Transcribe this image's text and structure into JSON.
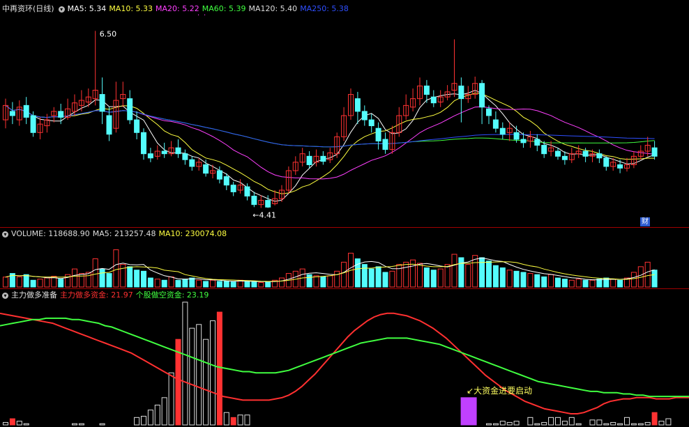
{
  "stock": {
    "name": "中再资环",
    "period": "(日线)"
  },
  "price_header": [
    {
      "label": "MA5: 5.34",
      "color": "#ffffff"
    },
    {
      "label": "MA10: 5.33",
      "color": "#ffff40"
    },
    {
      "label": "MA20: 5.22",
      "color": "#ff40ff"
    },
    {
      "label": "MA60: 5.39",
      "color": "#40ff40"
    },
    {
      "label": "MA120: 5.40",
      "color": "#dddddd"
    },
    {
      "label": "MA250: 5.38",
      "color": "#2f4fff"
    }
  ],
  "volume_header": [
    {
      "label": "VOLUME: 118688.90",
      "color": "#dddddd"
    },
    {
      "label": "MA5: 213257.48",
      "color": "#dddddd"
    },
    {
      "label": "MA10: 230074.08",
      "color": "#ffff40"
    }
  ],
  "indicator_header": {
    "name": "主力做多准备",
    "items": [
      {
        "label": "主力做多资金: 21.97",
        "color": "#ff3030"
      },
      {
        "label": "个股做空资金: 23.19",
        "color": "#40ff40"
      }
    ]
  },
  "annotations": {
    "high_label": "6.50",
    "low_label": "4.41",
    "signal_label": "大资金进要启动",
    "finance_badge": "财"
  },
  "colors": {
    "up": "#ff3232",
    "down": "#54fcfc",
    "grid": "#8b0000",
    "signal": "#c040ff"
  },
  "chart_data": [
    {
      "type": "candlestick",
      "title": "中再资环 (日线)",
      "ylim": [
        4.25,
        6.7
      ],
      "high_marker": 6.5,
      "low_marker": 4.41,
      "candles": [
        [
          5.45,
          5.62,
          5.7,
          5.35
        ],
        [
          5.55,
          5.5,
          5.66,
          5.4
        ],
        [
          5.45,
          5.6,
          5.68,
          5.38
        ],
        [
          5.62,
          5.48,
          5.72,
          5.4
        ],
        [
          5.5,
          5.3,
          5.55,
          5.25
        ],
        [
          5.3,
          5.4,
          5.48,
          5.22
        ],
        [
          5.38,
          5.45,
          5.52,
          5.3
        ],
        [
          5.5,
          5.55,
          5.6,
          5.42
        ],
        [
          5.55,
          5.48,
          5.64,
          5.4
        ],
        [
          5.48,
          5.58,
          5.7,
          5.45
        ],
        [
          5.55,
          5.65,
          5.75,
          5.5
        ],
        [
          5.62,
          5.68,
          5.8,
          5.55
        ],
        [
          5.66,
          5.72,
          5.82,
          5.6
        ],
        [
          5.7,
          5.8,
          6.5,
          5.62
        ],
        [
          5.75,
          5.55,
          5.95,
          5.4
        ],
        [
          5.5,
          5.28,
          5.6,
          5.2
        ],
        [
          5.35,
          5.68,
          5.9,
          5.3
        ],
        [
          5.7,
          5.75,
          5.9,
          5.6
        ],
        [
          5.7,
          5.45,
          5.8,
          5.4
        ],
        [
          5.45,
          5.3,
          5.55,
          5.22
        ],
        [
          5.3,
          5.05,
          5.35,
          4.98
        ],
        [
          5.05,
          5.0,
          5.12,
          4.95
        ],
        [
          5.02,
          5.08,
          5.15,
          4.98
        ],
        [
          5.08,
          5.05,
          5.18,
          5.0
        ],
        [
          5.05,
          5.12,
          5.2,
          5.02
        ],
        [
          5.12,
          5.05,
          5.22,
          5.0
        ],
        [
          5.05,
          4.98,
          5.1,
          4.92
        ],
        [
          4.98,
          4.9,
          5.02,
          4.85
        ],
        [
          4.9,
          4.95,
          5.0,
          4.85
        ],
        [
          4.92,
          4.82,
          4.98,
          4.78
        ],
        [
          4.82,
          4.85,
          4.92,
          4.76
        ],
        [
          4.85,
          4.75,
          4.9,
          4.7
        ],
        [
          4.78,
          4.68,
          4.82,
          4.62
        ],
        [
          4.68,
          4.6,
          4.72,
          4.55
        ],
        [
          4.62,
          4.68,
          4.75,
          4.58
        ],
        [
          4.66,
          4.55,
          4.7,
          4.5
        ],
        [
          4.55,
          4.45,
          4.6,
          4.42
        ],
        [
          4.45,
          4.5,
          4.56,
          4.41
        ],
        [
          4.5,
          4.42,
          4.56,
          4.41
        ],
        [
          4.46,
          4.52,
          4.62,
          4.44
        ],
        [
          4.52,
          4.62,
          4.68,
          4.48
        ],
        [
          4.62,
          4.85,
          4.9,
          4.58
        ],
        [
          4.85,
          4.95,
          5.02,
          4.8
        ],
        [
          4.95,
          5.05,
          5.12,
          4.9
        ],
        [
          5.02,
          4.92,
          5.08,
          4.88
        ],
        [
          4.95,
          5.02,
          5.1,
          4.9
        ],
        [
          5.02,
          4.96,
          5.08,
          4.92
        ],
        [
          4.98,
          5.06,
          5.12,
          4.94
        ],
        [
          5.05,
          5.25,
          5.3,
          5.0
        ],
        [
          5.25,
          5.5,
          5.6,
          5.2
        ],
        [
          5.5,
          5.75,
          5.82,
          5.45
        ],
        [
          5.7,
          5.55,
          5.78,
          5.4
        ],
        [
          5.55,
          5.45,
          5.62,
          5.38
        ],
        [
          5.45,
          5.38,
          5.52,
          5.3
        ],
        [
          5.35,
          5.2,
          5.42,
          5.1
        ],
        [
          5.22,
          5.1,
          5.3,
          5.05
        ],
        [
          5.1,
          5.3,
          5.38,
          5.05
        ],
        [
          5.3,
          5.5,
          5.6,
          5.25
        ],
        [
          5.5,
          5.62,
          5.75,
          5.45
        ],
        [
          5.6,
          5.7,
          5.82,
          5.55
        ],
        [
          5.7,
          5.85,
          5.95,
          5.62
        ],
        [
          5.85,
          5.75,
          5.92,
          5.65
        ],
        [
          5.72,
          5.65,
          5.8,
          5.6
        ],
        [
          5.66,
          5.72,
          5.8,
          5.6
        ],
        [
          5.72,
          5.78,
          5.86,
          5.68
        ],
        [
          5.8,
          5.88,
          6.4,
          5.72
        ],
        [
          5.85,
          5.7,
          5.95,
          5.42
        ],
        [
          5.7,
          5.75,
          5.85,
          5.65
        ],
        [
          5.75,
          5.88,
          5.96,
          5.7
        ],
        [
          5.88,
          5.6,
          5.92,
          5.4
        ],
        [
          5.58,
          5.5,
          5.62,
          5.4
        ],
        [
          5.45,
          5.35,
          5.55,
          5.3
        ],
        [
          5.35,
          5.28,
          5.42,
          5.22
        ],
        [
          5.3,
          5.35,
          5.42,
          5.2
        ],
        [
          5.3,
          5.22,
          5.38,
          5.18
        ],
        [
          5.22,
          5.18,
          5.3,
          5.12
        ],
        [
          5.2,
          5.25,
          5.32,
          5.12
        ],
        [
          5.22,
          5.15,
          5.28,
          5.08
        ],
        [
          5.15,
          5.05,
          5.2,
          5.0
        ],
        [
          5.08,
          5.12,
          5.2,
          5.02
        ],
        [
          5.08,
          5.02,
          5.12,
          4.98
        ],
        [
          5.02,
          4.98,
          5.08,
          4.92
        ],
        [
          4.98,
          5.05,
          5.12,
          4.94
        ],
        [
          5.05,
          5.08,
          5.15,
          5.0
        ],
        [
          5.08,
          5.02,
          5.12,
          4.95
        ],
        [
          5.02,
          5.05,
          5.1,
          4.95
        ],
        [
          5.05,
          5.0,
          5.1,
          4.94
        ],
        [
          5.0,
          4.9,
          5.02,
          4.85
        ],
        [
          4.9,
          4.95,
          5.0,
          4.85
        ],
        [
          4.92,
          4.88,
          4.98,
          4.82
        ],
        [
          4.88,
          4.92,
          5.0,
          4.84
        ],
        [
          4.92,
          5.02,
          5.08,
          4.88
        ],
        [
          5.02,
          5.08,
          5.15,
          4.98
        ],
        [
          5.08,
          5.15,
          5.25,
          5.02
        ],
        [
          5.12,
          5.02,
          5.2,
          4.98
        ]
      ]
    },
    {
      "type": "bar",
      "title": "VOLUME",
      "ylim": [
        0,
        420000
      ],
      "values": [
        88000,
        120000,
        90000,
        110000,
        60000,
        70000,
        80000,
        95000,
        70000,
        110000,
        160000,
        120000,
        130000,
        250000,
        160000,
        120000,
        330000,
        200000,
        180000,
        150000,
        140000,
        80000,
        70000,
        60000,
        90000,
        60000,
        70000,
        80000,
        60000,
        50000,
        60000,
        50000,
        50000,
        45000,
        60000,
        50000,
        45000,
        40000,
        45000,
        60000,
        80000,
        120000,
        140000,
        160000,
        110000,
        100000,
        90000,
        100000,
        140000,
        220000,
        300000,
        250000,
        200000,
        160000,
        180000,
        130000,
        140000,
        200000,
        220000,
        240000,
        210000,
        170000,
        150000,
        160000,
        200000,
        290000,
        260000,
        200000,
        280000,
        260000,
        230000,
        190000,
        170000,
        150000,
        140000,
        130000,
        120000,
        110000,
        90000,
        110000,
        80000,
        70000,
        60000,
        70000,
        60000,
        60000,
        70000,
        80000,
        70000,
        60000,
        80000,
        130000,
        180000,
        220000,
        150000
      ]
    },
    {
      "type": "line",
      "title": "主力做多准备",
      "ylim": [
        0,
        100
      ],
      "series": [
        {
          "name": "主力做多资金",
          "color": "#ff3030",
          "values": [
            90,
            89,
            88,
            87,
            86,
            85,
            84,
            83,
            82,
            80,
            78,
            76,
            74,
            72,
            70,
            68,
            66,
            64,
            62,
            60,
            58,
            55,
            52,
            49,
            46,
            43,
            40,
            37,
            35,
            33,
            31,
            29,
            27,
            25,
            23,
            22,
            21,
            20,
            20,
            20,
            20,
            20,
            21,
            22,
            24,
            27,
            31,
            36,
            41,
            47,
            53,
            59,
            65,
            71,
            76,
            80,
            84,
            87,
            89,
            90,
            90,
            89,
            88,
            86,
            84,
            81,
            78,
            74,
            70,
            65,
            60,
            55,
            50,
            45,
            40,
            36,
            32,
            28,
            25,
            22,
            19,
            17,
            15,
            13,
            12,
            11,
            10,
            9,
            9,
            10,
            12,
            14,
            17,
            19,
            20,
            21,
            21,
            22,
            22,
            22,
            21,
            21,
            21,
            22,
            22,
            22
          ]
        },
        {
          "name": "个股做空资金",
          "color": "#40ff40",
          "values": [
            80,
            81,
            82,
            83,
            84,
            85,
            85,
            86,
            86,
            86,
            86,
            85,
            85,
            84,
            83,
            82,
            80,
            79,
            77,
            75,
            73,
            71,
            69,
            67,
            65,
            63,
            61,
            59,
            57,
            55,
            53,
            51,
            49,
            47,
            46,
            45,
            44,
            43,
            43,
            42,
            42,
            42,
            42,
            43,
            44,
            46,
            48,
            50,
            52,
            54,
            56,
            58,
            60,
            62,
            64,
            66,
            67,
            68,
            69,
            70,
            70,
            70,
            70,
            69,
            68,
            67,
            66,
            65,
            63,
            61,
            59,
            57,
            55,
            53,
            51,
            49,
            47,
            45,
            43,
            41,
            39,
            37,
            35,
            34,
            33,
            32,
            31,
            30,
            29,
            28,
            27,
            27,
            26,
            26,
            26,
            25,
            25,
            24,
            24,
            23,
            23,
            23,
            23,
            23,
            23,
            23
          ]
        }
      ],
      "bars": [
        2,
        5,
        3,
        1,
        0,
        0,
        0,
        0,
        0,
        0,
        1,
        1,
        0,
        0,
        1,
        0,
        0,
        0,
        0,
        6,
        7,
        12,
        16,
        22,
        42,
        69,
        99,
        78,
        81,
        69,
        84,
        91,
        10,
        6,
        8,
        8,
        0,
        0,
        0,
        0,
        0,
        0,
        0,
        0,
        0,
        0,
        0,
        0,
        0,
        0,
        0,
        0,
        0,
        0,
        0,
        0,
        0,
        0,
        0,
        0,
        0,
        0,
        0,
        0,
        0,
        0,
        0,
        0,
        0,
        0,
        1,
        1,
        3,
        2,
        3,
        0,
        6,
        1,
        2,
        6,
        6,
        3,
        6,
        1,
        0,
        4,
        4,
        1,
        2,
        1,
        6,
        1,
        1,
        2,
        10,
        3,
        5
      ],
      "signal_bar_index": 69,
      "signal_value": 22
    }
  ]
}
